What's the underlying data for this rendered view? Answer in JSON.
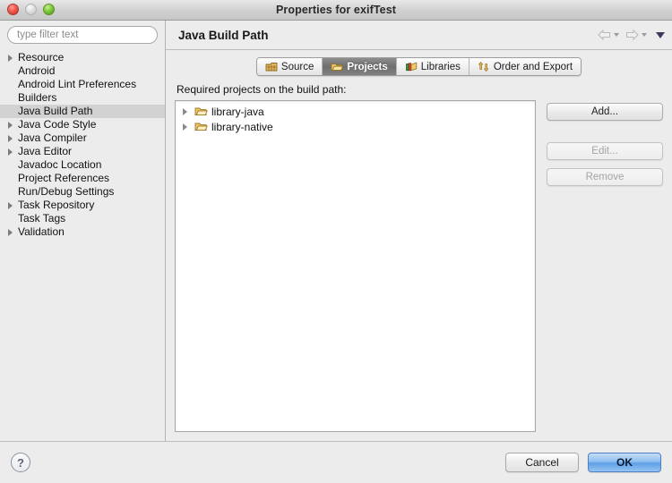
{
  "window": {
    "title": "Properties for exifTest",
    "traffic_lights": [
      "close-button",
      "minimize-button",
      "zoom-button"
    ]
  },
  "sidebar": {
    "filter": {
      "placeholder": "type filter text",
      "value": ""
    },
    "items": [
      {
        "label": "Resource",
        "expandable": true,
        "selected": false
      },
      {
        "label": "Android",
        "expandable": false,
        "selected": false
      },
      {
        "label": "Android Lint Preferences",
        "expandable": false,
        "selected": false
      },
      {
        "label": "Builders",
        "expandable": false,
        "selected": false
      },
      {
        "label": "Java Build Path",
        "expandable": false,
        "selected": true
      },
      {
        "label": "Java Code Style",
        "expandable": true,
        "selected": false
      },
      {
        "label": "Java Compiler",
        "expandable": true,
        "selected": false
      },
      {
        "label": "Java Editor",
        "expandable": true,
        "selected": false
      },
      {
        "label": "Javadoc Location",
        "expandable": false,
        "selected": false
      },
      {
        "label": "Project References",
        "expandable": false,
        "selected": false
      },
      {
        "label": "Run/Debug Settings",
        "expandable": false,
        "selected": false
      },
      {
        "label": "Task Repository",
        "expandable": true,
        "selected": false
      },
      {
        "label": "Task Tags",
        "expandable": false,
        "selected": false
      },
      {
        "label": "Validation",
        "expandable": true,
        "selected": false
      }
    ]
  },
  "content": {
    "page_title": "Java Build Path",
    "nav": {
      "back": "back-arrow",
      "forward": "forward-arrow",
      "menu": "view-menu-chevron"
    },
    "tabs": [
      {
        "label": "Source",
        "icon": "source-package-icon",
        "active": false
      },
      {
        "label": "Projects",
        "icon": "projects-folder-icon",
        "active": true
      },
      {
        "label": "Libraries",
        "icon": "libraries-books-icon",
        "active": false
      },
      {
        "label": "Order and Export",
        "icon": "order-export-arrows-icon",
        "active": false
      }
    ],
    "group_label": "Required projects on the build path:",
    "projects": [
      {
        "name": "library-java",
        "icon": "folder-icon",
        "expandable": true
      },
      {
        "name": "library-native",
        "icon": "folder-icon",
        "expandable": true
      }
    ],
    "side_buttons": [
      {
        "label": "Add...",
        "enabled": true
      },
      {
        "label": "Edit...",
        "enabled": false
      },
      {
        "label": "Remove",
        "enabled": false
      }
    ]
  },
  "footer": {
    "help_label": "?",
    "cancel_label": "Cancel",
    "ok_label": "OK"
  },
  "colors": {
    "window_bg": "#ececec",
    "selection": "#d2d2d2",
    "active_tab": "#6f6f6f",
    "ok_blue": "#5e9fe6",
    "folder_yellow": "#f0c060"
  }
}
